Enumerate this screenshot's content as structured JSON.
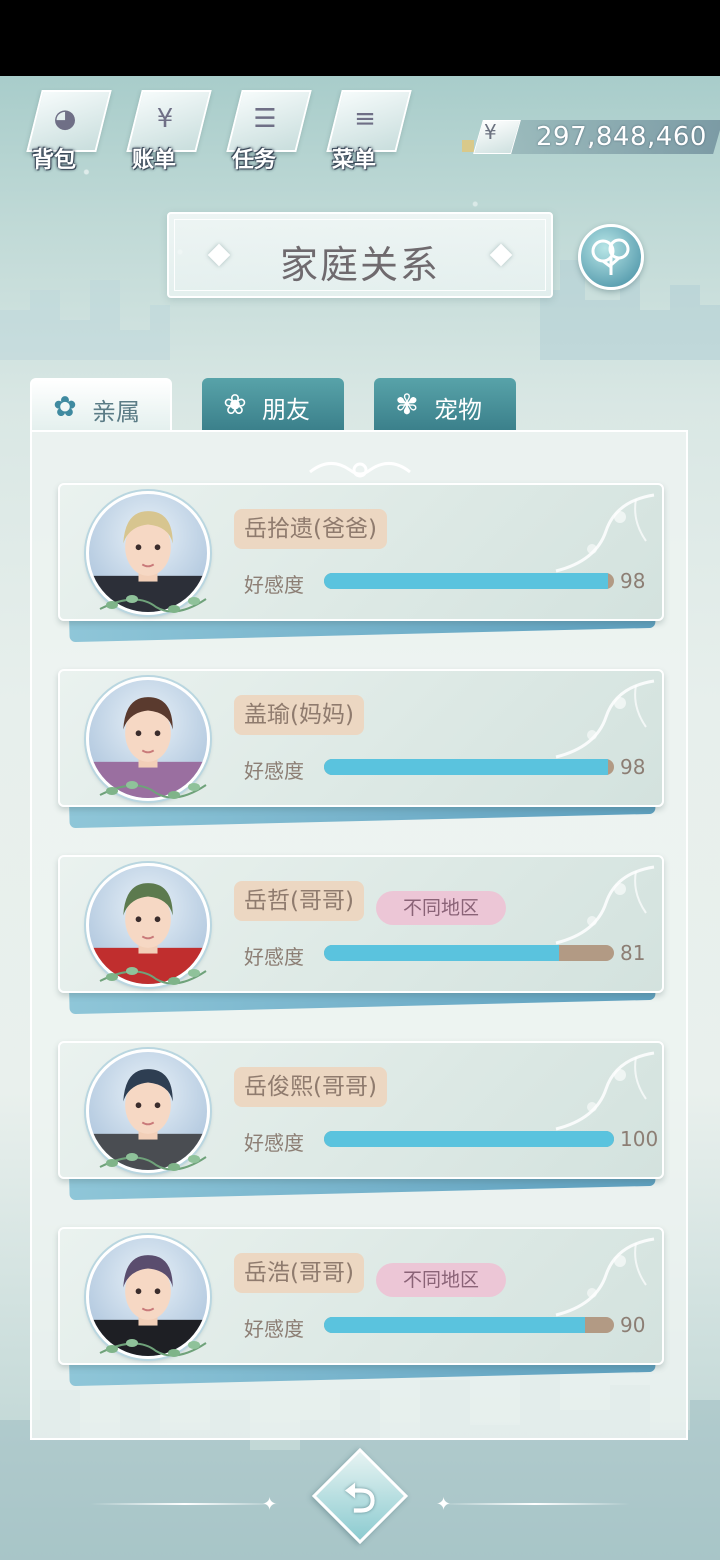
{
  "toolbar": {
    "items": [
      {
        "label": "背包",
        "icon": "backpack-icon",
        "glyph": "◕"
      },
      {
        "label": "账单",
        "icon": "bill-icon",
        "glyph": "¥"
      },
      {
        "label": "任务",
        "icon": "task-icon",
        "glyph": "☰"
      },
      {
        "label": "菜单",
        "icon": "menu-icon",
        "glyph": "≡"
      }
    ]
  },
  "money": {
    "symbol": "¥",
    "amount": "297,848,460"
  },
  "header": {
    "title": "家庭关系",
    "tree_icon": "family-tree-icon"
  },
  "tabs": [
    {
      "label": "亲属",
      "active": true
    },
    {
      "label": "朋友",
      "active": false
    },
    {
      "label": "宠物",
      "active": false
    }
  ],
  "favor_label": "好感度",
  "members": [
    {
      "name": "岳拾遗(爸爸)",
      "favor": "98",
      "region": "",
      "hair": "#d7c58f",
      "shirt": "#2c2f38"
    },
    {
      "name": "盖瑜(妈妈)",
      "favor": "98",
      "region": "",
      "hair": "#5a3a2e",
      "shirt": "#9a6fa0"
    },
    {
      "name": "岳哲(哥哥)",
      "favor": "81",
      "region": "不同地区",
      "hair": "#5c7a4e",
      "shirt": "#c02e2e"
    },
    {
      "name": "岳俊熙(哥哥)",
      "favor": "100",
      "region": "",
      "hair": "#2e3e52",
      "shirt": "#4a4d52"
    },
    {
      "name": "岳浩(哥哥)",
      "favor": "90",
      "region": "不同地区",
      "hair": "#5a4d6e",
      "shirt": "#1e1f24"
    }
  ],
  "bottom": {
    "back_glyph": "⮌"
  },
  "colors": {
    "bar_fill": "#5ac3de",
    "bar_track": "#b29a84",
    "name_tag": "#ecd7c2",
    "region_tag": "#ecc6d6"
  }
}
